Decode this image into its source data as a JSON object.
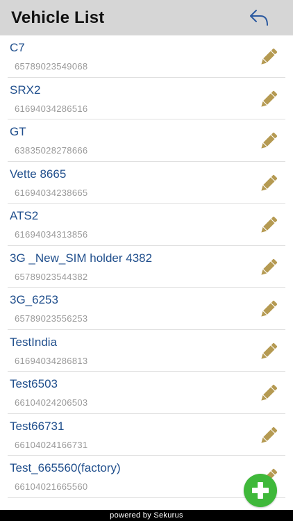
{
  "header": {
    "title": "Vehicle List",
    "back_icon": "back-arrow-icon"
  },
  "colors": {
    "accent_blue": "#1f4e8c",
    "edit_gold": "#b59a52",
    "add_green": "#3fb83a"
  },
  "vehicles": [
    {
      "name": "C7",
      "id": "65789023549068"
    },
    {
      "name": "SRX2",
      "id": "61694034286516"
    },
    {
      "name": "GT",
      "id": "63835028278666"
    },
    {
      "name": "Vette 8665",
      "id": "61694034238665"
    },
    {
      "name": "ATS2",
      "id": "61694034313856"
    },
    {
      "name": "3G _New_SIM holder 4382",
      "id": "65789023544382"
    },
    {
      "name": "3G_6253",
      "id": "65789023556253"
    },
    {
      "name": "TestIndia",
      "id": "61694034286813"
    },
    {
      "name": "Test6503",
      "id": "66104024206503"
    },
    {
      "name": "Test66731",
      "id": "66104024166731"
    },
    {
      "name": "Test_665560(factory)",
      "id": "66104021665560"
    }
  ],
  "footer": {
    "text": "powered by Sekurus"
  }
}
